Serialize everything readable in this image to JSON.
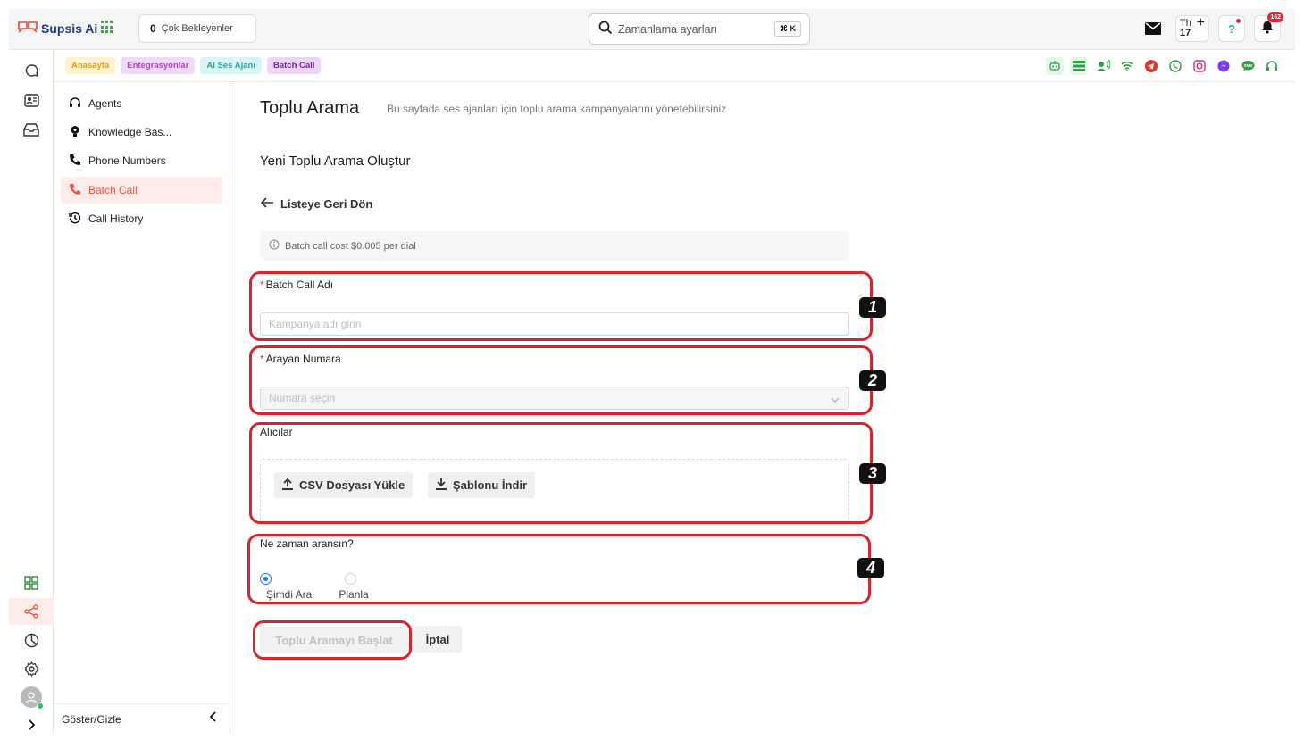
{
  "app": {
    "name": "Supsis Ai"
  },
  "header": {
    "pending_count": "0",
    "pending_label": "Çok Bekleyenler",
    "search_placeholder": "Zamanlama ayarları",
    "search_shortcut": "⌘ K",
    "calendar_day": "Th",
    "calendar_date": "17",
    "notification_count": "162"
  },
  "tags": [
    "Anasayfa",
    "Entegrasyonlar",
    "AI Ses Ajanı",
    "Batch Call"
  ],
  "subnav": {
    "items": [
      {
        "label": "Agents",
        "icon": "headset-icon"
      },
      {
        "label": "Knowledge Bas...",
        "icon": "bulb-icon"
      },
      {
        "label": "Phone Numbers",
        "icon": "phone-icon"
      },
      {
        "label": "Batch Call",
        "icon": "phone-icon",
        "active": true
      },
      {
        "label": "Call History",
        "icon": "history-icon"
      }
    ],
    "toggle_label": "Göster/Gizle"
  },
  "page": {
    "title": "Toplu Arama",
    "subtitle": "Bu sayfada ses ajanları için toplu arama kampanyalarını yönetebilirsiniz",
    "section_title": "Yeni Toplu Arama Oluştur",
    "back_label": "Listeye Geri Dön",
    "info_text": "Batch call cost $0.005 per dial"
  },
  "form": {
    "name_label": "Batch Call Adı",
    "name_placeholder": "Kampanya adı girin",
    "caller_label": "Arayan Numara",
    "caller_placeholder": "Numara seçin",
    "recipients_label": "Alıcılar",
    "upload_label": "CSV Dosyası Yükle",
    "template_label": "Şablonu İndir",
    "when_label": "Ne zaman aransın?",
    "option_now": "Şimdi Ara",
    "option_schedule": "Planla",
    "selected_option": "Şimdi Ara",
    "start_label": "Toplu Aramayı Başlat",
    "cancel_label": "İptal"
  },
  "annotations": [
    "1",
    "2",
    "3",
    "4"
  ],
  "colors": {
    "accent": "#e8533f",
    "annotation_red": "#d7242e",
    "radio_blue": "#1677ff"
  }
}
